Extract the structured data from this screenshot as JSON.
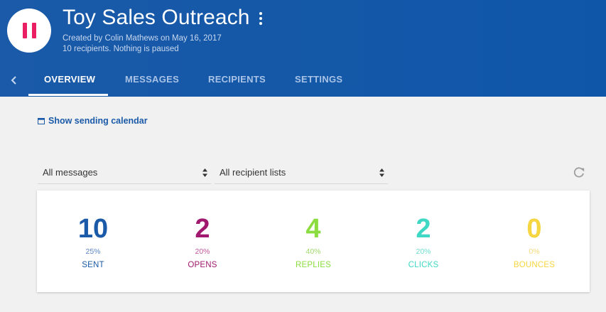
{
  "campaign": {
    "title": "Toy Sales Outreach",
    "created_by": "Created by Colin Mathews on May 16, 2017",
    "status": "10 recipients. Nothing is paused",
    "avatar_icon": "pause-icon",
    "avatar_color": "#e91e63"
  },
  "tabs": [
    {
      "label": "OVERVIEW",
      "active": true
    },
    {
      "label": "MESSAGES",
      "active": false
    },
    {
      "label": "RECIPIENTS",
      "active": false
    },
    {
      "label": "SETTINGS",
      "active": false
    }
  ],
  "calendar_link": "Show sending calendar",
  "filters": {
    "messages": "All messages",
    "recipients": "All recipient lists"
  },
  "stats": [
    {
      "value": "10",
      "percent": "25%",
      "label": "SENT",
      "color": "#1a5aa8",
      "pct_color": "#5a85c2"
    },
    {
      "value": "2",
      "percent": "20%",
      "label": "OPENS",
      "color": "#a0196e",
      "pct_color": "#c0559a"
    },
    {
      "value": "4",
      "percent": "40%",
      "label": "REPLIES",
      "color": "#8bdc3e",
      "pct_color": "#9fd96a"
    },
    {
      "value": "2",
      "percent": "20%",
      "label": "CLICKS",
      "color": "#3fd8c4",
      "pct_color": "#6ddccd"
    },
    {
      "value": "0",
      "percent": "0%",
      "label": "BOUNCES",
      "color": "#f5d640",
      "pct_color": "#f2d97a"
    }
  ]
}
